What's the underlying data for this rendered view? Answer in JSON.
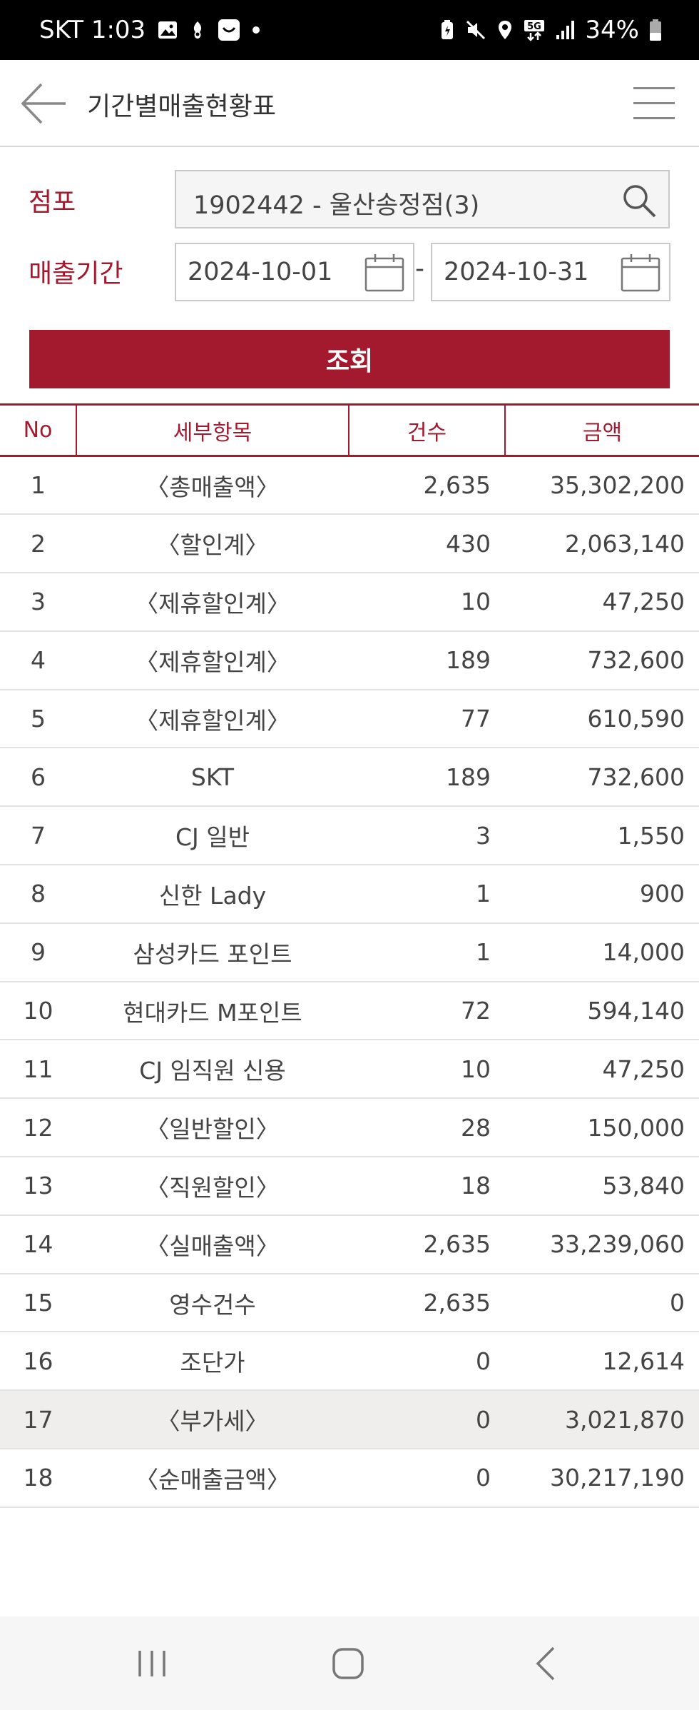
{
  "status_bar": {
    "time": "SKT 1:03",
    "battery": "34%"
  },
  "header": {
    "title": "기간별매출현황표"
  },
  "form": {
    "store_label": "점포",
    "store_value": "1902442 - 울산송정점(3)",
    "period_label": "매출기간",
    "start_date": "2024-10-01",
    "date_separator": "-",
    "end_date": "2024-10-31",
    "query_button": "조회"
  },
  "table": {
    "headers": {
      "no": "No",
      "item": "세부항목",
      "count": "건수",
      "amount": "금액"
    },
    "rows": [
      {
        "no": "1",
        "item": "〈총매출액〉",
        "count": "2,635",
        "amount": "35,302,200"
      },
      {
        "no": "2",
        "item": "〈할인계〉",
        "count": "430",
        "amount": "2,063,140"
      },
      {
        "no": "3",
        "item": "〈제휴할인계〉",
        "count": "10",
        "amount": "47,250"
      },
      {
        "no": "4",
        "item": "〈제휴할인계〉",
        "count": "189",
        "amount": "732,600"
      },
      {
        "no": "5",
        "item": "〈제휴할인계〉",
        "count": "77",
        "amount": "610,590"
      },
      {
        "no": "6",
        "item": "SKT",
        "count": "189",
        "amount": "732,600"
      },
      {
        "no": "7",
        "item": "CJ 일반",
        "count": "3",
        "amount": "1,550"
      },
      {
        "no": "8",
        "item": "신한 Lady",
        "count": "1",
        "amount": "900"
      },
      {
        "no": "9",
        "item": "삼성카드 포인트",
        "count": "1",
        "amount": "14,000"
      },
      {
        "no": "10",
        "item": "현대카드 M포인트",
        "count": "72",
        "amount": "594,140"
      },
      {
        "no": "11",
        "item": "CJ 임직원 신용",
        "count": "10",
        "amount": "47,250"
      },
      {
        "no": "12",
        "item": "〈일반할인〉",
        "count": "28",
        "amount": "150,000"
      },
      {
        "no": "13",
        "item": "〈직원할인〉",
        "count": "18",
        "amount": "53,840"
      },
      {
        "no": "14",
        "item": "〈실매출액〉",
        "count": "2,635",
        "amount": "33,239,060"
      },
      {
        "no": "15",
        "item": "영수건수",
        "count": "2,635",
        "amount": "0"
      },
      {
        "no": "16",
        "item": "조단가",
        "count": "0",
        "amount": "12,614"
      },
      {
        "no": "17",
        "item": "〈부가세〉",
        "count": "0",
        "amount": "3,021,870"
      },
      {
        "no": "18",
        "item": "〈순매출금액〉",
        "count": "0",
        "amount": "30,217,190"
      }
    ]
  },
  "colors": {
    "accent": "#a3192e",
    "highlight_row": "#f0eeec"
  }
}
